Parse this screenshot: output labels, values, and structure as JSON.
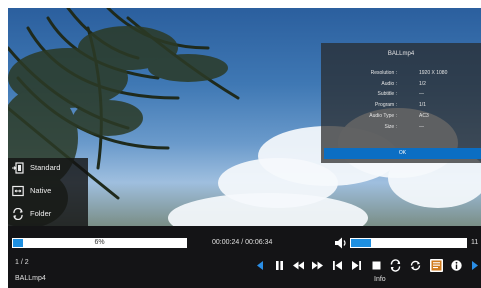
{
  "info_panel": {
    "title": "BALLmp4",
    "rows": [
      {
        "label": "Resolution :",
        "value": "1920 X 1080"
      },
      {
        "label": "Audio :",
        "value": "1/2"
      },
      {
        "label": "Subtitle :",
        "value": "—"
      },
      {
        "label": "Program :",
        "value": "1/1"
      },
      {
        "label": "Audio Type :",
        "value": "AC3"
      },
      {
        "label": "Size :",
        "value": "—"
      }
    ],
    "ok_label": "OK"
  },
  "side_menu": {
    "items": [
      {
        "label": "Standard",
        "icon": "picture-mode-icon"
      },
      {
        "label": "Native",
        "icon": "aspect-ratio-icon"
      },
      {
        "label": "Folder",
        "icon": "repeat-folder-icon"
      }
    ]
  },
  "player": {
    "progress_label": "6%",
    "progress_percent": 6,
    "time_display": "00:00:24 / 00:06:34",
    "volume_value": "11",
    "volume_fraction": 0.17,
    "page_counter": "1 / 2",
    "file_name": "BALLmp4",
    "selected_caption": "Info"
  },
  "colors": {
    "accent": "#1e8fe0",
    "ok_button": "#0b6ec3",
    "bar_background": "#141416"
  }
}
